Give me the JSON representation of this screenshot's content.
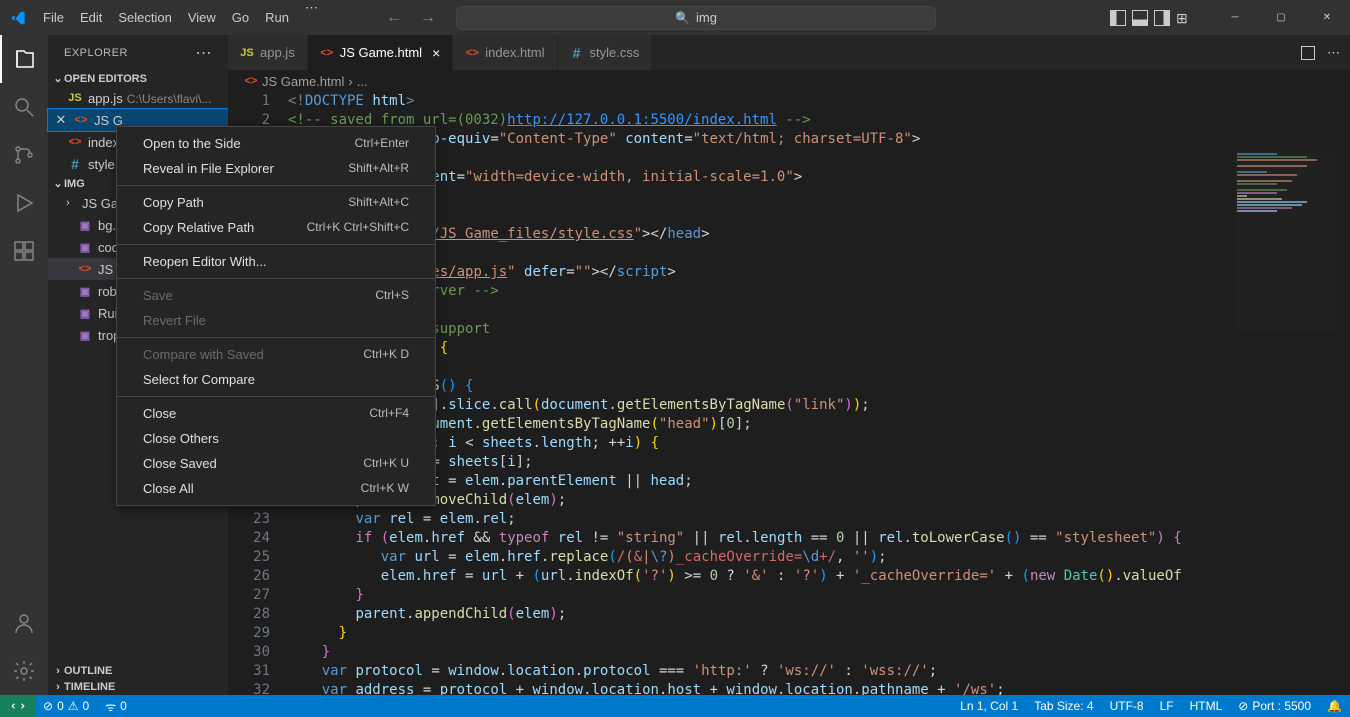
{
  "menu": [
    "File",
    "Edit",
    "Selection",
    "View",
    "Go",
    "Run"
  ],
  "search_text": "img",
  "sidebar": {
    "title": "EXPLORER",
    "sections": {
      "open_editors": "OPEN EDITORS",
      "folder": "IMG",
      "outline": "OUTLINE",
      "timeline": "TIMELINE"
    },
    "open_editors_items": [
      {
        "icon": "js",
        "label": "app.js",
        "hint": "C:\\Users\\flavi\\..."
      },
      {
        "icon": "html",
        "label": "JS G",
        "hint": ""
      },
      {
        "icon": "html",
        "label": "index.html",
        "hint": ""
      },
      {
        "icon": "css",
        "label": "style.css",
        "hint": ""
      }
    ],
    "folder_items": [
      {
        "type": "folder",
        "label": "JS Game_files"
      },
      {
        "type": "img",
        "label": "bg.png"
      },
      {
        "type": "img",
        "label": "code.png"
      },
      {
        "type": "html",
        "label": "JS Game.html",
        "selected": true
      },
      {
        "type": "img",
        "label": "robot.png"
      },
      {
        "type": "img",
        "label": "Ruido.png"
      },
      {
        "type": "img",
        "label": "trophy.png"
      }
    ]
  },
  "tabs": [
    {
      "icon": "js",
      "label": "app.js",
      "active": false
    },
    {
      "icon": "html",
      "label": "JS Game.html",
      "active": true,
      "close": true
    },
    {
      "icon": "html",
      "label": "index.html",
      "active": false
    },
    {
      "icon": "css",
      "label": "style.css",
      "active": false
    }
  ],
  "breadcrumb": [
    "JS Game.html",
    "..."
  ],
  "gutter_start": 1,
  "gutter_end": 32,
  "context_menu": [
    {
      "label": "Open to the Side",
      "key": "Ctrl+Enter"
    },
    {
      "label": "Reveal in File Explorer",
      "key": "Shift+Alt+R"
    },
    {
      "sep": true
    },
    {
      "label": "Copy Path",
      "key": "Shift+Alt+C"
    },
    {
      "label": "Copy Relative Path",
      "key": "Ctrl+K Ctrl+Shift+C"
    },
    {
      "sep": true
    },
    {
      "label": "Reopen Editor With..."
    },
    {
      "sep": true
    },
    {
      "label": "Save",
      "key": "Ctrl+S",
      "disabled": true
    },
    {
      "label": "Revert File",
      "disabled": true
    },
    {
      "sep": true
    },
    {
      "label": "Compare with Saved",
      "key": "Ctrl+K D",
      "disabled": true
    },
    {
      "label": "Select for Compare"
    },
    {
      "sep": true
    },
    {
      "label": "Close",
      "key": "Ctrl+F4"
    },
    {
      "label": "Close Others"
    },
    {
      "label": "Close Saved",
      "key": "Ctrl+K U"
    },
    {
      "label": "Close All",
      "key": "Ctrl+K W"
    }
  ],
  "status": {
    "errors": "0",
    "warnings": "0",
    "port_left": "0",
    "ln_col": "Ln 1, Col 1",
    "tab_size": "Tab Size: 4",
    "encoding": "UTF-8",
    "eol": "LF",
    "lang": "HTML",
    "port": "Port : 5500"
  },
  "code_lines": [
    "<!DOCTYPE html>",
    "saved_from",
    "meta",
    "blank",
    "viewport",
    "blank",
    "title",
    "stylesheet",
    "blank",
    "script",
    "liveserver",
    "blank",
    "svg",
    "window",
    "cbrace",
    "refresh",
    "sheets",
    "head",
    "forloop",
    "elem",
    "parent",
    "removechild",
    "rel",
    "ifhref",
    "varurl",
    "elemhref",
    "closebrace",
    "appendchild",
    "closebrace2",
    "closebrace3",
    "protocol",
    "address"
  ]
}
